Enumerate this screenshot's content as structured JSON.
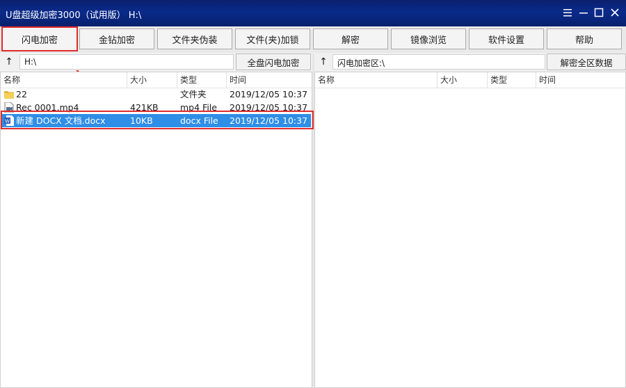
{
  "window": {
    "title": "U盘超级加密3000（试用版） H:\\",
    "icons": [
      "menu-icon",
      "minimize-icon",
      "maximize-icon",
      "close-icon"
    ]
  },
  "toolbar": {
    "buttons": [
      {
        "label": "闪电加密",
        "highlighted": true
      },
      {
        "label": "金钻加密"
      },
      {
        "label": "文件夹伪装"
      },
      {
        "label": "文件(夹)加锁"
      },
      {
        "label": "解密"
      },
      {
        "label": "镜像浏览"
      },
      {
        "label": "软件设置"
      },
      {
        "label": "帮助"
      }
    ]
  },
  "left": {
    "up_symbol": "↑",
    "path": "H:\\",
    "action_label": "全盘闪电加密",
    "columns": [
      "名称",
      "大小",
      "类型",
      "时间"
    ],
    "rows": [
      {
        "icon": "folder-icon",
        "name": "22",
        "size": "",
        "type": "文件夹",
        "time": "2019/12/05 10:37"
      },
      {
        "icon": "video-file-icon",
        "name": "Rec 0001.mp4",
        "size": "421KB",
        "type": "mp4 File",
        "time": "2019/12/05 10:37"
      },
      {
        "icon": "word-doc-icon",
        "name": "新建 DOCX 文档.docx",
        "size": "10KB",
        "type": "docx File",
        "time": "2019/12/05 10:37",
        "selected": true
      }
    ]
  },
  "right": {
    "up_symbol": "↑",
    "path": "闪电加密区:\\",
    "action_label": "解密全区数据",
    "columns": [
      "名称",
      "大小",
      "类型",
      "时间"
    ],
    "rows": []
  },
  "colors": {
    "titlebar": "#0a2a8a",
    "selection": "#2f8ee6",
    "highlight_border": "#e02b2b"
  }
}
